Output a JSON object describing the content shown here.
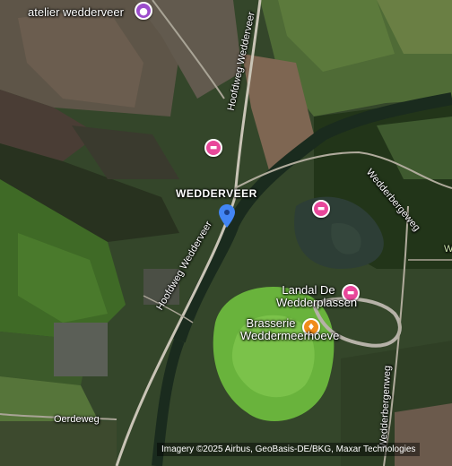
{
  "map": {
    "type": "satellite",
    "place": {
      "name": "WEDDERVEER"
    },
    "pois": [
      {
        "name": "atelier wedderveer",
        "category": "art",
        "color": "#9c4dcc",
        "icon": "palette-icon"
      },
      {
        "name": "",
        "category": "lodging",
        "color": "#e8479a",
        "icon": "bed-icon"
      },
      {
        "name": "",
        "category": "lodging",
        "color": "#e8479a",
        "icon": "bed-icon"
      },
      {
        "name": "Landal De Wedderplassen",
        "category": "lodging",
        "color": "#e8479a",
        "icon": "bed-icon"
      },
      {
        "name": "Brasserie Weddermeerhoeve",
        "category": "restaurant",
        "color": "#f08c1a",
        "icon": "fork-knife-icon"
      }
    ],
    "roads": [
      {
        "name": "Hoofdweg Wedderveer"
      },
      {
        "name": "Hoofdweg Wedderveer"
      },
      {
        "name": "Wedderbergeweg"
      },
      {
        "name": "Wedderbergenweg"
      },
      {
        "name": "Oerdeweg"
      },
      {
        "name": "W"
      }
    ],
    "pin": {
      "color": "#4285f4",
      "icon": "location-pin-icon"
    },
    "attribution": "Imagery ©2025 Airbus, GeoBasis-DE/BKG, Maxar Technologies"
  }
}
